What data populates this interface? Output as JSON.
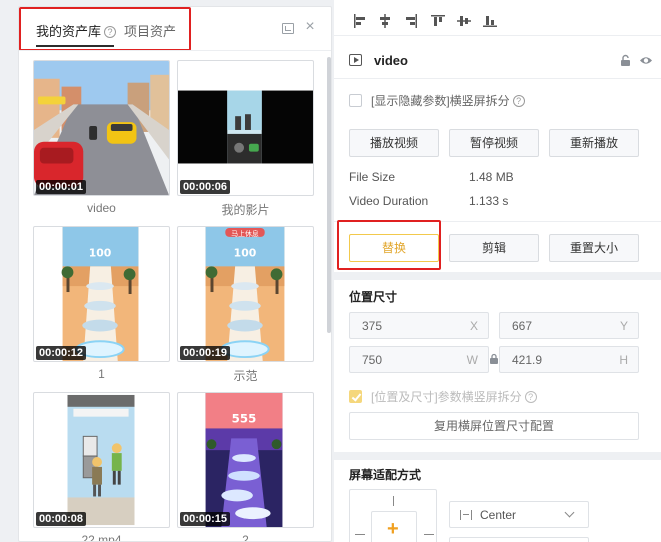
{
  "assets_panel": {
    "tabs": [
      {
        "label": "我的资产库",
        "active": true
      },
      {
        "label": "项目资产",
        "active": false
      }
    ],
    "help_icon": "question-circle-icon",
    "items": [
      {
        "name": "video",
        "duration": "00:00:01"
      },
      {
        "name": "我的影片",
        "duration": "00:00:06"
      },
      {
        "name": "1",
        "duration": "00:00:12"
      },
      {
        "name": "示范",
        "duration": "00:00:19"
      },
      {
        "name": "22.mp4",
        "duration": "00:00:08"
      },
      {
        "name": "2",
        "duration": "00:00:15"
      }
    ],
    "thumb_text": {
      "score_a": "100",
      "score_b": "555",
      "banner_b": "马上休息"
    }
  },
  "properties_panel": {
    "title": "video",
    "show_hidden_params": {
      "label": "[显示隐藏参数]横竖屏拆分",
      "checked": false
    },
    "playback_buttons": [
      "播放视频",
      "暂停视频",
      "重新播放"
    ],
    "info": [
      {
        "label": "File Size",
        "value": "1.48 MB"
      },
      {
        "label": "Video Duration",
        "value": "1.133 s"
      }
    ],
    "edit_buttons": [
      "替换",
      "剪辑",
      "重置大小"
    ],
    "position_size": {
      "title": "位置尺寸",
      "x": "375",
      "y": "667",
      "w": "750",
      "h": "421.9",
      "axis_labels": {
        "x": "X",
        "y": "Y",
        "w": "W",
        "h": "H"
      },
      "split_option": {
        "label": "[位置及尺寸]参数横竖屏拆分",
        "checked": true
      },
      "reuse_button": "复用横屏位置尺寸配置"
    },
    "screen_fit": {
      "title": "屏幕适配方式",
      "mode": "Center"
    }
  },
  "colors": {
    "accent": "#f2c94c",
    "accent_text": "#e2a62b",
    "highlight": "#e02020"
  }
}
